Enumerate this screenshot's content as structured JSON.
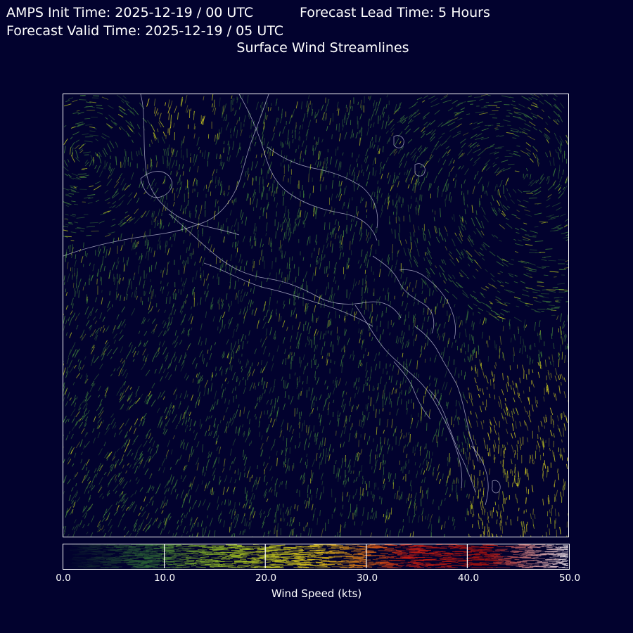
{
  "header": {
    "init_time": "AMPS Init Time: 2025-12-19 / 00 UTC",
    "lead_time": "Forecast Lead Time: 5 Hours",
    "valid_time": "Forecast Valid Time: 2025-12-19 / 05 UTC",
    "title": "Surface Wind Streamlines"
  },
  "map": {
    "background_color": "#02022e",
    "coastline_color": "#c8c8e0",
    "streamline_low_color": "#3f7f3a",
    "streamline_mid_color": "#b8c420",
    "streamline_high_color": "#e8e020"
  },
  "colorbar": {
    "label": "Wind Speed (kts)",
    "range": [
      0,
      50
    ],
    "ticks": [
      "0.0",
      "10.0",
      "20.0",
      "30.0",
      "40.0",
      "50.0"
    ],
    "colors": [
      "#02022e",
      "#2f6a36",
      "#9fbf22",
      "#d4b51a",
      "#c21e14",
      "#9a1010",
      "#e6e6f0"
    ]
  }
}
